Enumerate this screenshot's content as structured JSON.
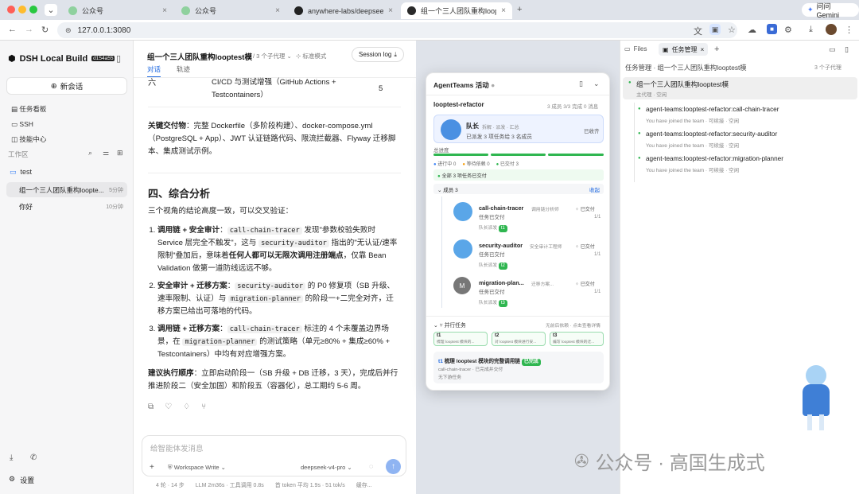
{
  "tabs": [
    {
      "label": "公众号"
    },
    {
      "label": "公众号"
    },
    {
      "label": "anywhere-labs/deepseek-ha"
    },
    {
      "label": "组一个三人团队重构looptest模"
    }
  ],
  "browser": {
    "url": "127.0.0.1:3080",
    "gemini": "问问 Gemini"
  },
  "sidebar": {
    "brand": "DSH Local Build",
    "version": "d154a55",
    "new_chat": "新会话",
    "nav": [
      {
        "label": "任务看板"
      },
      {
        "label": "SSH"
      },
      {
        "label": "技能中心"
      }
    ],
    "workspace_label": "工作区",
    "folder": "test",
    "chats": [
      {
        "label": "组一个三人团队重构loopte...",
        "time": "5分钟"
      },
      {
        "label": "你好",
        "time": "10分钟"
      }
    ],
    "settings": "设置"
  },
  "chat": {
    "title": "组一个三人团队重构looptest模",
    "subagents": "3 个子代理",
    "mode": "标准模式",
    "session_log": "Session log",
    "tabs": [
      "对话",
      "轨迹"
    ],
    "table_row": {
      "c1": "六",
      "c2": "CI/CD 与测试增强（GitHub Actions + Testcontainers）",
      "c3": "5"
    },
    "deliverables_label": "关键交付物",
    "deliverables_text": "：完整 Dockerfile（多阶段构建）、docker-compose.yml（PostgreSQL + App）、JWT 认证链路代码、限流拦截器、Flyway 迁移脚本、集成测试示例。",
    "section_title": "四、综合分析",
    "intro": "三个视角的结论高度一致，可以交叉验证：",
    "items": [
      {
        "lead": "调用链 + 安全审计",
        "p1": "：",
        "code1": "call-chain-tracer",
        "p2": " 发现\"参数校验失败时 Service 层完全不触发\"，这与 ",
        "code2": "security-auditor",
        "p3": " 指出的\"无认证/速率限制\"叠加后，意味着",
        "bold": "任何人都可以无限次调用注册端点",
        "p4": "，仅靠 Bean Validation 做第一道防线远远不够。"
      },
      {
        "lead": "安全审计 + 迁移方案",
        "p1": "：",
        "code1": "security-auditor",
        "p2": " 的 P0 修复项（SB 升级、速率限制、认证）与 ",
        "code2": "migration-planner",
        "p3": " 的阶段一+二完全对齐，迁移方案已给出可落地的代码。",
        "bold": "",
        "p4": ""
      },
      {
        "lead": "调用链 + 迁移方案",
        "p1": "：",
        "code1": "call-chain-tracer",
        "p2": " 标注的 4 个未覆盖边界场景，在 ",
        "code2": "migration-planner",
        "p3": " 的测试策略（单元≥80% + 集成≥60% + Testcontainers）中均有对应增强方案。",
        "bold": "",
        "p4": ""
      }
    ],
    "suggest_label": "建议执行顺序",
    "suggest_text": "：立即启动阶段一（SB 升级 + DB 迁移，3 天），完成后并行推进阶段二（安全加固）和阶段五（容器化），总工期约 5-6 周。",
    "input_placeholder": "给智能体发消息",
    "workspace_write": "Workspace Write",
    "model": "deepseek-v4-pro",
    "status": [
      "4 轮 · 14 步",
      "LLM 2m36s · 工具调用 0.8s",
      "首 token 平均 1.9s · 51 tok/s",
      "缓存..."
    ]
  },
  "agent": {
    "title": "AgentTeams 活动",
    "team": "looptest-refactor",
    "stats": "3 成员  3/3 完成  0 消息",
    "leader": {
      "role": "队长",
      "tags": "拆解 · 派发 · 汇总",
      "desc": "已派发 3 项任务给 3 名成员",
      "state": "已收齐"
    },
    "progress_label": "总进度",
    "legend": [
      {
        "label": "进行中 0",
        "color": "#3b82f6"
      },
      {
        "label": "等待依赖 0",
        "color": "#f59e0b"
      },
      {
        "label": "已交付 3",
        "color": "#2fb650"
      }
    ],
    "all_delivered": "全部 3 项任务已交付",
    "members_label": "成员 3",
    "collapse": "收起",
    "members": [
      {
        "name": "call-chain-tracer",
        "role": "调用链分析师",
        "status": "任务已交付",
        "from": "队长派发",
        "task": "t1",
        "state": "已交付",
        "count": "1/1"
      },
      {
        "name": "security-auditor",
        "role": "安全审计工程师",
        "status": "任务已交付",
        "from": "队长派发",
        "task": "t2",
        "state": "已交付",
        "count": "1/1"
      },
      {
        "name": "migration-plan...",
        "role": "迁移方案...",
        "status": "任务已交付",
        "from": "队长派发",
        "task": "t3",
        "state": "已交付",
        "count": "1/1",
        "avatar": "M"
      }
    ],
    "parallel_label": "并行任务",
    "parallel_hint": "无前后依赖 · 点击查看详情",
    "tasks": [
      {
        "id": "t1",
        "text": "梳理 looptest 模块的..."
      },
      {
        "id": "t2",
        "text": "对 looptest 模块进行安..."
      },
      {
        "id": "t3",
        "text": "编写 looptest 模块的迁..."
      }
    ],
    "detail": {
      "id": "t1",
      "title": "梳理 looptest 模块的完整调用链",
      "badge": "已完成",
      "line1": "call-chain-tracer · 已完成并交付",
      "line2": "无下游任务"
    }
  },
  "right": {
    "tabs": [
      "Files",
      "任务管理"
    ],
    "header": "任务管理 · 组一个三人团队重构looptest模",
    "header_count": "3 个子代理",
    "items": [
      {
        "title": "组一个三人团队重构looptest模",
        "sub": "主代理 · 空闲"
      },
      {
        "title": "agent-teams:looptest-refactor:call-chain-tracer",
        "sub": "You have joined the team · 可续接 · 空闲"
      },
      {
        "title": "agent-teams:looptest-refactor:security-auditor",
        "sub": "You have joined the team · 可续接 · 空闲"
      },
      {
        "title": "agent-teams:looptest-refactor:migration-planner",
        "sub": "You have joined the team · 可续接 · 空闲"
      }
    ]
  },
  "watermark": "公众号 · 高国生成式"
}
